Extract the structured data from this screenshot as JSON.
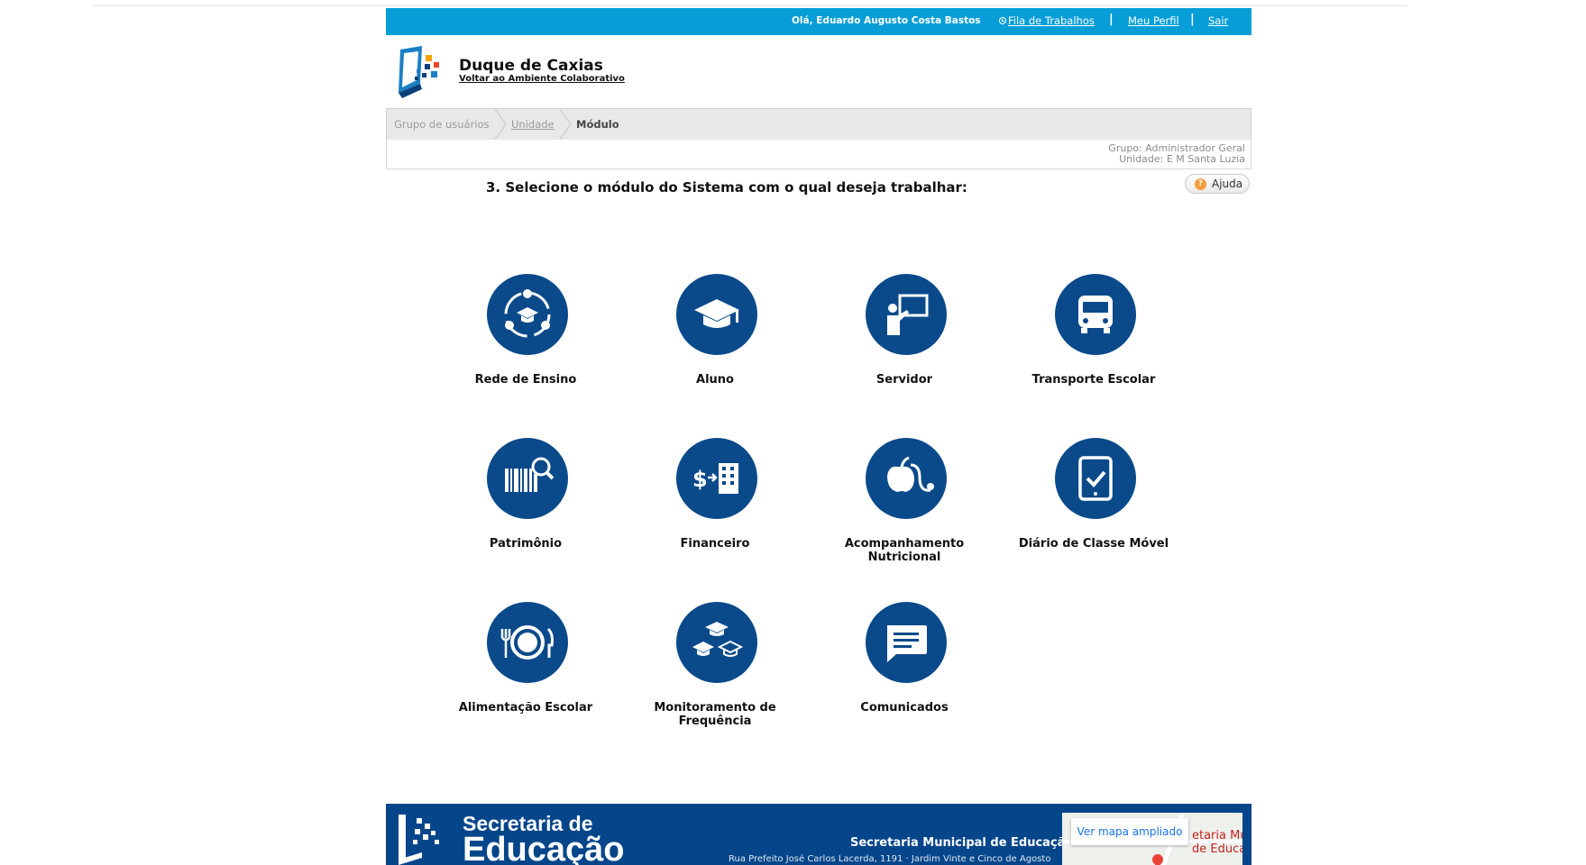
{
  "topbar": {
    "greeting": "Olá, Eduardo Augusto Costa Bastos",
    "queue_link": "Fila de Trabalhos",
    "profile_link": "Meu Perfil",
    "logout_link": "Sair",
    "separator": "|"
  },
  "header": {
    "brand": "Duque de Caxias",
    "back_link": "Voltar ao Ambiente Colaborativo"
  },
  "breadcrumb": {
    "items": [
      "Grupo de usuários",
      "Unidade",
      "Módulo"
    ]
  },
  "context": {
    "group": "Grupo: Administrador Geral",
    "unit": "Unidade: E M Santa Luzia"
  },
  "instructions": "3. Selecione o módulo do Sistema com o qual deseja trabalhar:",
  "help_label": "Ajuda",
  "modules": [
    {
      "label": "Rede de Ensino",
      "icon": "school-network-icon"
    },
    {
      "label": "Aluno",
      "icon": "graduation-cap-icon"
    },
    {
      "label": "Servidor",
      "icon": "teacher-board-icon"
    },
    {
      "label": "Transporte Escolar",
      "icon": "bus-icon"
    },
    {
      "label": "Patrimônio",
      "icon": "barcode-search-icon"
    },
    {
      "label": "Financeiro",
      "icon": "money-building-icon"
    },
    {
      "label": "Acompanhamento Nutricional",
      "icon": "apple-stethoscope-icon"
    },
    {
      "label": "Diário de Classe Móvel",
      "icon": "tablet-check-icon"
    },
    {
      "label": "Alimentação Escolar",
      "icon": "plate-cutlery-icon"
    },
    {
      "label": "Monitoramento de Frequência",
      "icon": "graduation-caps-icon"
    },
    {
      "label": "Comunicados",
      "icon": "chat-icon"
    }
  ],
  "footer": {
    "logo_line1": "Secretaria de",
    "logo_line2": "Educação",
    "title": "Secretaria Municipal de Educação",
    "subtitle": "Rua Prefeito José Carlos Lacerda, 1191 · Jardim Vinte e Cinco de Agosto",
    "map_button": "Ver mapa ampliado",
    "map_text_line1": "etaria Mu",
    "map_text_line2": "de Educação"
  },
  "colors": {
    "topbar": "#079ed8",
    "module_circle": "#0a4a8a",
    "footer": "#05468a"
  }
}
